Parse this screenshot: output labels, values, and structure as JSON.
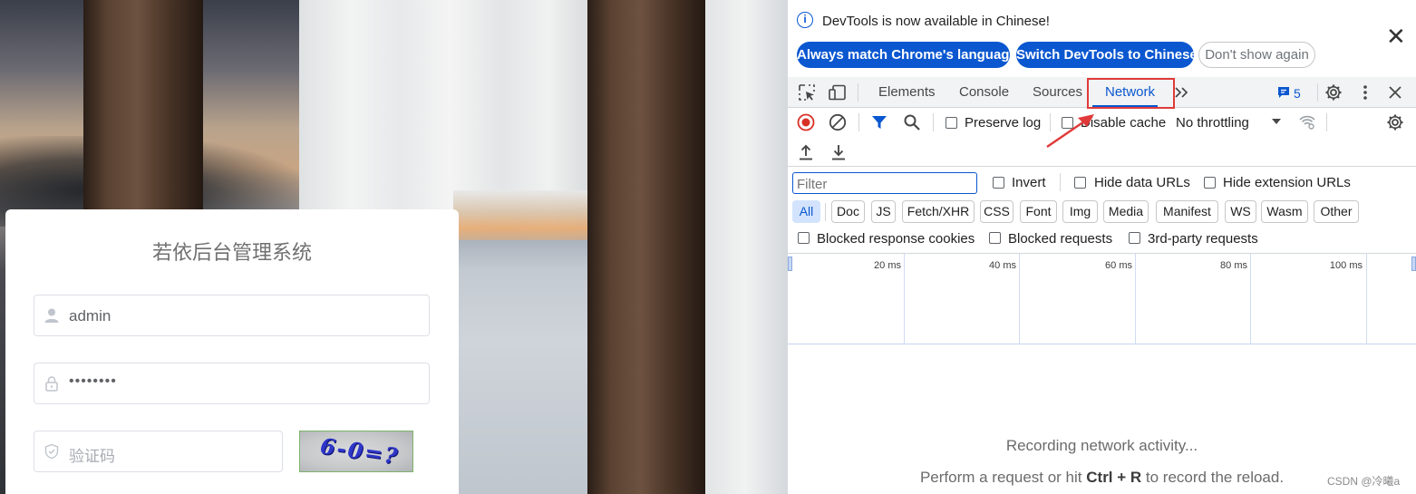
{
  "login": {
    "title": "若依后台管理系统",
    "username_value": "admin",
    "password_value": "••••••••",
    "captcha_placeholder": "验证码",
    "captcha_image_text": "6-0=?"
  },
  "devtools": {
    "info": {
      "message": "DevTools is now available in Chinese!",
      "btn_match": "Always match Chrome's language",
      "btn_switch": "Switch DevTools to Chinese",
      "btn_dont_show": "Don't show again"
    },
    "tabs": [
      "Elements",
      "Console",
      "Sources",
      "Network"
    ],
    "active_tab": "Network",
    "issues_count": "5",
    "toolbar": {
      "preserve_log": "Preserve log",
      "disable_cache": "Disable cache",
      "throttling": "No throttling"
    },
    "filter": {
      "placeholder": "Filter",
      "invert": "Invert",
      "hide_data_urls": "Hide data URLs",
      "hide_extension_urls": "Hide extension URLs"
    },
    "type_filters": [
      "All",
      "Doc",
      "JS",
      "Fetch/XHR",
      "CSS",
      "Font",
      "Img",
      "Media",
      "Manifest",
      "WS",
      "Wasm",
      "Other"
    ],
    "blocked": {
      "cookies": "Blocked response cookies",
      "requests": "Blocked requests",
      "third_party": "3rd-party requests"
    },
    "timeline_ticks": [
      "20 ms",
      "40 ms",
      "60 ms",
      "80 ms",
      "100 ms"
    ],
    "empty": {
      "title": "Recording network activity...",
      "sub_prefix": "Perform a request or hit ",
      "sub_keys": "Ctrl + R",
      "sub_suffix": " to record the reload."
    },
    "watermark": "CSDN @冷曦a"
  },
  "colors": {
    "accent": "#0b57d0",
    "highlight_box": "#e03a3a",
    "record": "#d93025"
  }
}
